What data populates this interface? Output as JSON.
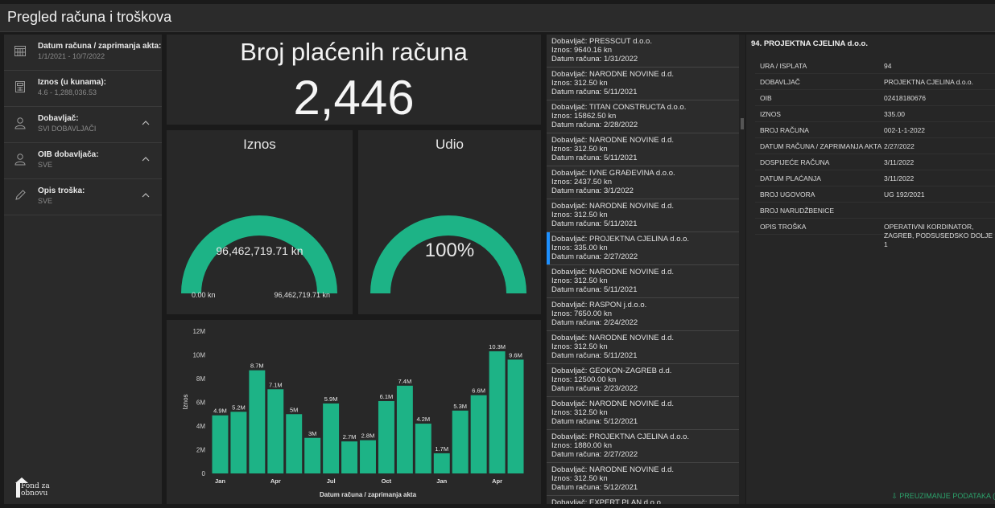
{
  "app": {
    "title": "Pregled računa i troškova"
  },
  "filters": [
    {
      "title": "Datum računa / zaprimanja akta:",
      "value": "1/1/2021 - 10/7/2022",
      "icon": "calendar-icon"
    },
    {
      "title": "Iznos (u kunama):",
      "value": "4.6 - 1,288,036.53",
      "icon": "calculator-icon"
    },
    {
      "title": "Dobavljač:",
      "value": "SVI DOBAVLJAČI",
      "icon": "person-icon"
    },
    {
      "title": "OIB dobavljača:",
      "value": "SVE",
      "icon": "person-icon"
    },
    {
      "title": "Opis troška:",
      "value": "SVE",
      "icon": "pencil-icon"
    }
  ],
  "logo": {
    "line1": "Fond za",
    "line2": "obnovu"
  },
  "kpi": {
    "title": "Broj plaćenih računa",
    "value": "2,446"
  },
  "gauge_amount": {
    "title": "Iznos",
    "value": "96,462,719.71 kn",
    "min": "0.00 kn",
    "max": "96,462,719.71 kn",
    "fraction": 1.0
  },
  "gauge_share": {
    "title": "Udio",
    "value": "100%",
    "fraction": 1.0
  },
  "colors": {
    "accent": "#1db386",
    "selected": "#1e90ff",
    "link": "#2ca36c"
  },
  "chart_data": {
    "type": "bar",
    "x": [
      "Jan 2021",
      "Feb 2021",
      "Mar 2021",
      "Apr 2021",
      "May 2021",
      "Jun 2021",
      "Jul 2021",
      "Aug 2021",
      "Sep 2021",
      "Oct 2021",
      "Nov 2021",
      "Dec 2021",
      "Jan 2022",
      "Feb 2022",
      "Mar 2022",
      "Apr 2022",
      "May 2022"
    ],
    "values": [
      4.9,
      5.2,
      8.7,
      7.1,
      5.0,
      3.0,
      5.9,
      2.7,
      2.8,
      6.1,
      7.4,
      4.2,
      1.7,
      5.3,
      6.6,
      10.3,
      9.6
    ],
    "labels": [
      "4.9M",
      "5.2M",
      "8.7M",
      "7.1M",
      "5M",
      "3M",
      "5.9M",
      "2.7M",
      "2.8M",
      "6.1M",
      "7.4M",
      "4.2M",
      "1.7M",
      "5.3M",
      "6.6M",
      "10.3M",
      "9.6M"
    ],
    "x_tick_labels": [
      {
        "index": 0,
        "label": "Jan"
      },
      {
        "index": 3,
        "label": "Apr"
      },
      {
        "index": 6,
        "label": "Jul"
      },
      {
        "index": 9,
        "label": "Oct"
      },
      {
        "index": 12,
        "label": "Jan"
      },
      {
        "index": 15,
        "label": "Apr"
      }
    ],
    "y_ticks": [
      "0",
      "2M",
      "4M",
      "6M",
      "8M",
      "10M",
      "12M"
    ],
    "ylim": [
      0,
      12
    ],
    "ylabel": "Iznos",
    "xlabel": "Datum računa / zaprimanja akta",
    "color": "#1db386"
  },
  "invoices": [
    {
      "supplier": "Dobavljač: PRESSCUT d.o.o.",
      "amount": "Iznos: 9640.16 kn",
      "date": "Datum računa: 1/31/2022"
    },
    {
      "supplier": "Dobavljač: NARODNE NOVINE d.d.",
      "amount": "Iznos: 312.50 kn",
      "date": "Datum računa: 5/11/2021"
    },
    {
      "supplier": "Dobavljač: TITAN CONSTRUCTA d.o.o.",
      "amount": "Iznos: 15862.50 kn",
      "date": "Datum računa: 2/28/2022"
    },
    {
      "supplier": "Dobavljač: NARODNE NOVINE d.d.",
      "amount": "Iznos: 312.50 kn",
      "date": "Datum računa: 5/11/2021"
    },
    {
      "supplier": "Dobavljač: IVNE GRAĐEVINA d.o.o.",
      "amount": "Iznos: 2437.50 kn",
      "date": "Datum računa: 3/1/2022"
    },
    {
      "supplier": "Dobavljač: NARODNE NOVINE d.d.",
      "amount": "Iznos: 312.50 kn",
      "date": "Datum računa: 5/11/2021"
    },
    {
      "supplier": "Dobavljač: PROJEKTNA CJELINA d.o.o.",
      "amount": "Iznos: 335.00 kn",
      "date": "Datum računa: 2/27/2022"
    },
    {
      "supplier": "Dobavljač: NARODNE NOVINE d.d.",
      "amount": "Iznos: 312.50 kn",
      "date": "Datum računa: 5/11/2021"
    },
    {
      "supplier": "Dobavljač: RASPON j.d.o.o.",
      "amount": "Iznos: 7650.00 kn",
      "date": "Datum računa: 2/24/2022"
    },
    {
      "supplier": "Dobavljač: NARODNE NOVINE d.d.",
      "amount": "Iznos: 312.50 kn",
      "date": "Datum računa: 5/11/2021"
    },
    {
      "supplier": "Dobavljač: GEOKON-ZAGREB d.d.",
      "amount": "Iznos: 12500.00 kn",
      "date": "Datum računa: 2/23/2022"
    },
    {
      "supplier": "Dobavljač: NARODNE NOVINE d.d.",
      "amount": "Iznos: 312.50 kn",
      "date": "Datum računa: 5/12/2021"
    },
    {
      "supplier": "Dobavljač: PROJEKTNA CJELINA d.o.o.",
      "amount": "Iznos: 1880.00 kn",
      "date": "Datum računa: 2/27/2022"
    },
    {
      "supplier": "Dobavljač: NARODNE NOVINE d.d.",
      "amount": "Iznos: 312.50 kn",
      "date": "Datum računa: 5/12/2021"
    },
    {
      "supplier": "Dobavljač: EXPERT PLAN d.o.o.",
      "amount": "",
      "date": ""
    }
  ],
  "selected_invoice_index": 6,
  "details": {
    "title": "94. PROJEKTNA CJELINA d.o.o.",
    "rows": [
      {
        "key": "URA / ISPLATA",
        "value": "94"
      },
      {
        "key": "DOBAVLJAČ",
        "value": "PROJEKTNA CJELINA d.o.o."
      },
      {
        "key": "OIB",
        "value": "02418180676"
      },
      {
        "key": "IZNOS",
        "value": "335.00"
      },
      {
        "key": "BROJ RAČUNA",
        "value": "002-1-1-2022"
      },
      {
        "key": "DATUM RAČUNA / ZAPRIMANJA AKTA",
        "value": "2/27/2022"
      },
      {
        "key": "DOSPIJEĆE RAČUNA",
        "value": "3/11/2022"
      },
      {
        "key": "DATUM PLAĆANJA",
        "value": "3/11/2022"
      },
      {
        "key": "BROJ UGOVORA",
        "value": "UG 192/2021"
      },
      {
        "key": "BROJ NARUDŽBENICE",
        "value": ""
      },
      {
        "key": "OPIS TROŠKA",
        "value": "OPERATIVNI KORDINATOR, ZAGREB, PODSUSEDSKO DOLJE 1"
      }
    ],
    "link": "⇩ PREUZIMANJE PODATAKA ("
  }
}
